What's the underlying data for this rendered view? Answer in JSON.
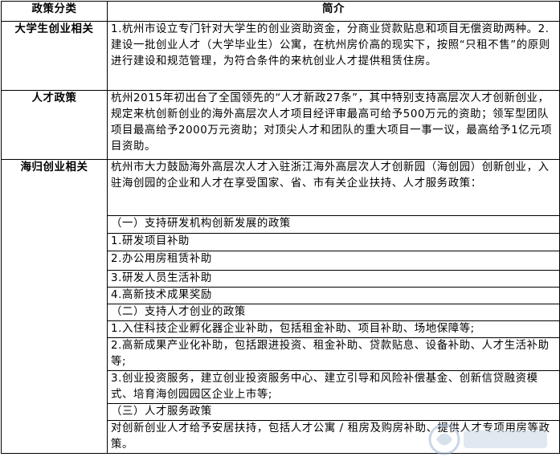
{
  "header": {
    "col1": "政策分类",
    "col2": "简介"
  },
  "rows": [
    {
      "category": "大学生创业相关",
      "text": "1.杭州市设立专门针对大学生的创业资助资金，分商业贷款贴息和项目无偿资助两种。2.建设一批创业人才（大学毕业生）公寓，在杭州房价高的现实下，按照“只租不售”的原则进行建设和规范管理，为符合条件的来杭创业人才提供租赁住房。"
    },
    {
      "category": "人才政策",
      "text": "杭州2015年初出台了全国领先的“人才新政27条”，其中特别支持高层次人才创新创业，规定来杭创新创业的海外高层次人才项目经评审最高可给予500万元的资助；领军型团队项目最高给予2000万元资助；对顶尖人才和团队的重大项目一事一议，最高给予1亿元项目资助。"
    }
  ],
  "overseas": {
    "category": "海归创业相关",
    "intro": "杭州市大力鼓励海外高层次人才入驻浙江海外高层次人才创新园（海创园）创新创业，入驻海创园的企业和人才在享受国家、省、市有关企业扶持、人才服务政策：",
    "items": [
      "（一）支持研发机构创新发展的政策",
      "1.研发项目补助",
      "2.办公用房租赁补助",
      "3.研发人员生活补助",
      "4.高新技术成果奖励",
      "（二）支持人才创业的政策",
      "1.入住科技企业孵化器企业补助，包括租金补助、项目补助、场地保障等;",
      "2.高新成果产业化补助，包括跟进投资、租金补助、贷款贴息、设备补助、人才生活补助等;",
      "3.创业投资服务，建立创业投资服务中心、建立引导和风险补偿基金、创新信贷融资模式、培育海创园园区企业上市等;",
      "（三）人才服务政策",
      "对创新创业人才给予安居扶持，包括人才公寓 / 租房及购房补助、提供人才专项用房等政策。"
    ]
  },
  "colors": {
    "border": "#000000",
    "text": "#000000",
    "background": "#ffffff"
  }
}
